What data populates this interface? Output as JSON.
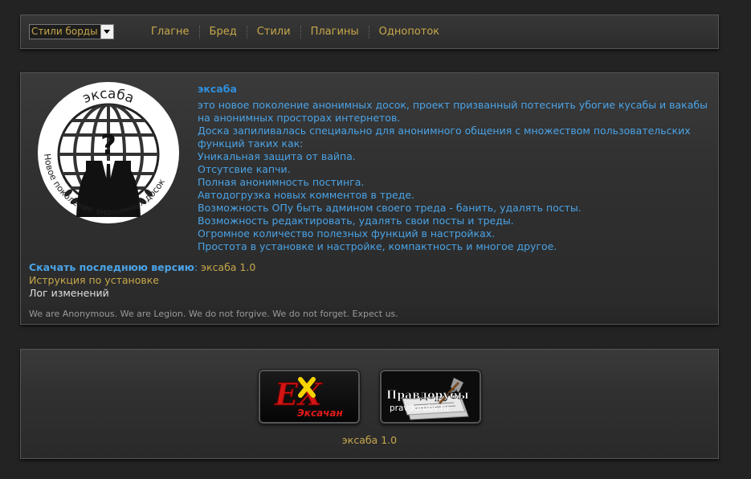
{
  "nav": {
    "style_select_value": "Стили борды",
    "links": [
      "Глагне",
      "Бред",
      "Стили",
      "Плагины",
      "Однопоток"
    ]
  },
  "info": {
    "logo_text_top": "эксаба",
    "logo_text_bottom": "Новое поколение анонимных досок",
    "title": "эксаба",
    "lines": [
      "это новое поколение анонимных досок, проект призванный потеснить убогие кусабы и вакабы на анонимных просторах интернетов.",
      "Доска запиливалась специально для анонимного общения с множеством пользовательских функций таких как:",
      "Уникальная защита от вайпа.",
      "Отсутсвие капчи.",
      "Полная анонимность постинга.",
      "Автодогрузка новых комментов в треде.",
      "Возможность ОПу быть админом своего треда - банить, удалять посты.",
      "Возможность редактировать, удалять свои посты и треды.",
      "Огромное количество полезных функций в настройках.",
      "Простота в установке и настройке, компактность и многое другое."
    ],
    "download_label": "Скачать последнюю версию",
    "download_colon": ":",
    "download_version": "эксаба 1.0",
    "install_link": "Иструкция по установке",
    "changelog_link": "Лог изменений",
    "motto": "We are Anonymous. We are Legion. We do not forgive. We do not forget. Expect us."
  },
  "banners": {
    "exchan_logo": "EX",
    "exchan_name": "Эксачан",
    "pravdorub_name": "Правдорубы",
    "pravdorub_url": "pravdorubs.ru",
    "version": "эксаба 1.0"
  },
  "colors": {
    "background": "#232323",
    "link_gold": "#c8a84b",
    "text_blue": "#4aa3e6"
  }
}
